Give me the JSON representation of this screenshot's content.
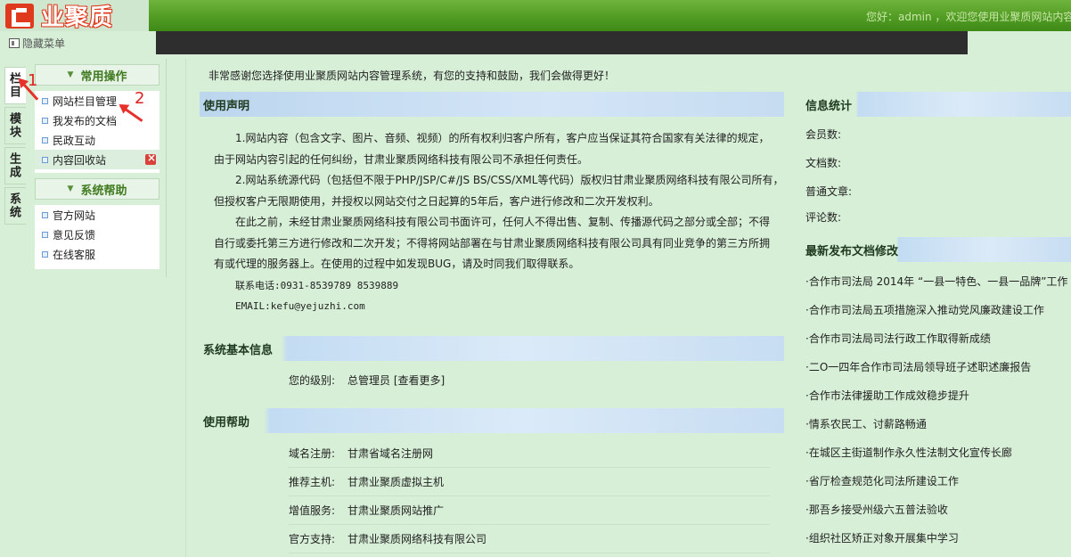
{
  "header": {
    "logo_text": "业聚质",
    "welcome": "您好：admin ，欢迎您使用业聚质网站内容",
    "hide_menu": "隐藏菜单"
  },
  "vtabs": [
    "栏目",
    "模块",
    "生成",
    "系统"
  ],
  "menu": {
    "groups": [
      {
        "title": "常用操作",
        "items": [
          "网站栏目管理",
          "我发布的文档",
          "民政互动",
          "内容回收站"
        ]
      },
      {
        "title": "系统帮助",
        "items": [
          "官方网站",
          "意见反馈",
          "在线客服"
        ]
      }
    ]
  },
  "annotations": {
    "one": "1",
    "two": "2"
  },
  "main": {
    "greeting": "非常感谢您选择使用业聚质网站内容管理系统，有您的支持和鼓励，我们会做得更好！",
    "usage": {
      "title": "使用声明",
      "p1": "1.网站内容（包含文字、图片、音频、视频）的所有权利归客户所有，客户应当保证其符合国家有关法律的规定，",
      "p1b": "由于网站内容引起的任何纠纷，甘肃业聚质网络科技有限公司不承担任何责任。",
      "p2": "2.网站系统源代码（包括但不限于PHP/JSP/C#/JS BS/CSS/XML等代码）版权归甘肃业聚质网络科技有限公司所有，",
      "p2b": "但授权客户无限期使用，并授权以网站交付之日起算的5年后，客户进行修改和二次开发权利。",
      "p3": "在此之前，未经甘肃业聚质网络科技有限公司书面许可，任何人不得出售、复制、传播源代码之部分或全部；不得",
      "p3b": "自行或委托第三方进行修改和二次开发；不得将网站部署在与甘肃业聚质网络科技有限公司具有同业竞争的第三方所拥",
      "p3c": "有或代理的服务器上。在使用的过程中如发现BUG，请及时同我们取得联系。",
      "phone": "联系电话:0931-8539789  8539889",
      "email": "EMAIL:kefu@yejuzhi.com"
    },
    "sysinfo": {
      "title": "系统基本信息",
      "level_label": "您的级别:",
      "level_value": "总管理员 [查看更多]"
    },
    "help": {
      "title": "使用帮助",
      "rows": [
        {
          "k": "域名注册:",
          "v": "甘肃省域名注册网"
        },
        {
          "k": "推荐主机:",
          "v": "甘肃业聚质虚拟主机"
        },
        {
          "k": "增值服务:",
          "v": "甘肃业聚质网站推广"
        },
        {
          "k": "官方支持:",
          "v": "甘肃业聚质网络科技有限公司"
        }
      ]
    },
    "stats": {
      "title": "信息统计",
      "members": "会员数:",
      "docs": "文档数:",
      "articles": "普通文章:",
      "comments": "评论数:"
    },
    "latest": {
      "title": "最新发布文档修改",
      "items": [
        "·合作市司法局 2014年 “一县一特色、一县一品牌”工作",
        "·合作市司法局五项措施深入推动党风廉政建设工作",
        "·合作市司法局司法行政工作取得新成绩",
        "·二O一四年合作市司法局领导班子述职述廉报告",
        "·合作市法律援助工作成效稳步提升",
        "·情系农民工、讨薪路畅通",
        "·在城区主街道制作永久性法制文化宣传长廊",
        "·省厅检查规范化司法所建设工作",
        "·那吾乡接受州级六五普法验收",
        "·组织社区矫正对象开展集中学习"
      ]
    }
  }
}
